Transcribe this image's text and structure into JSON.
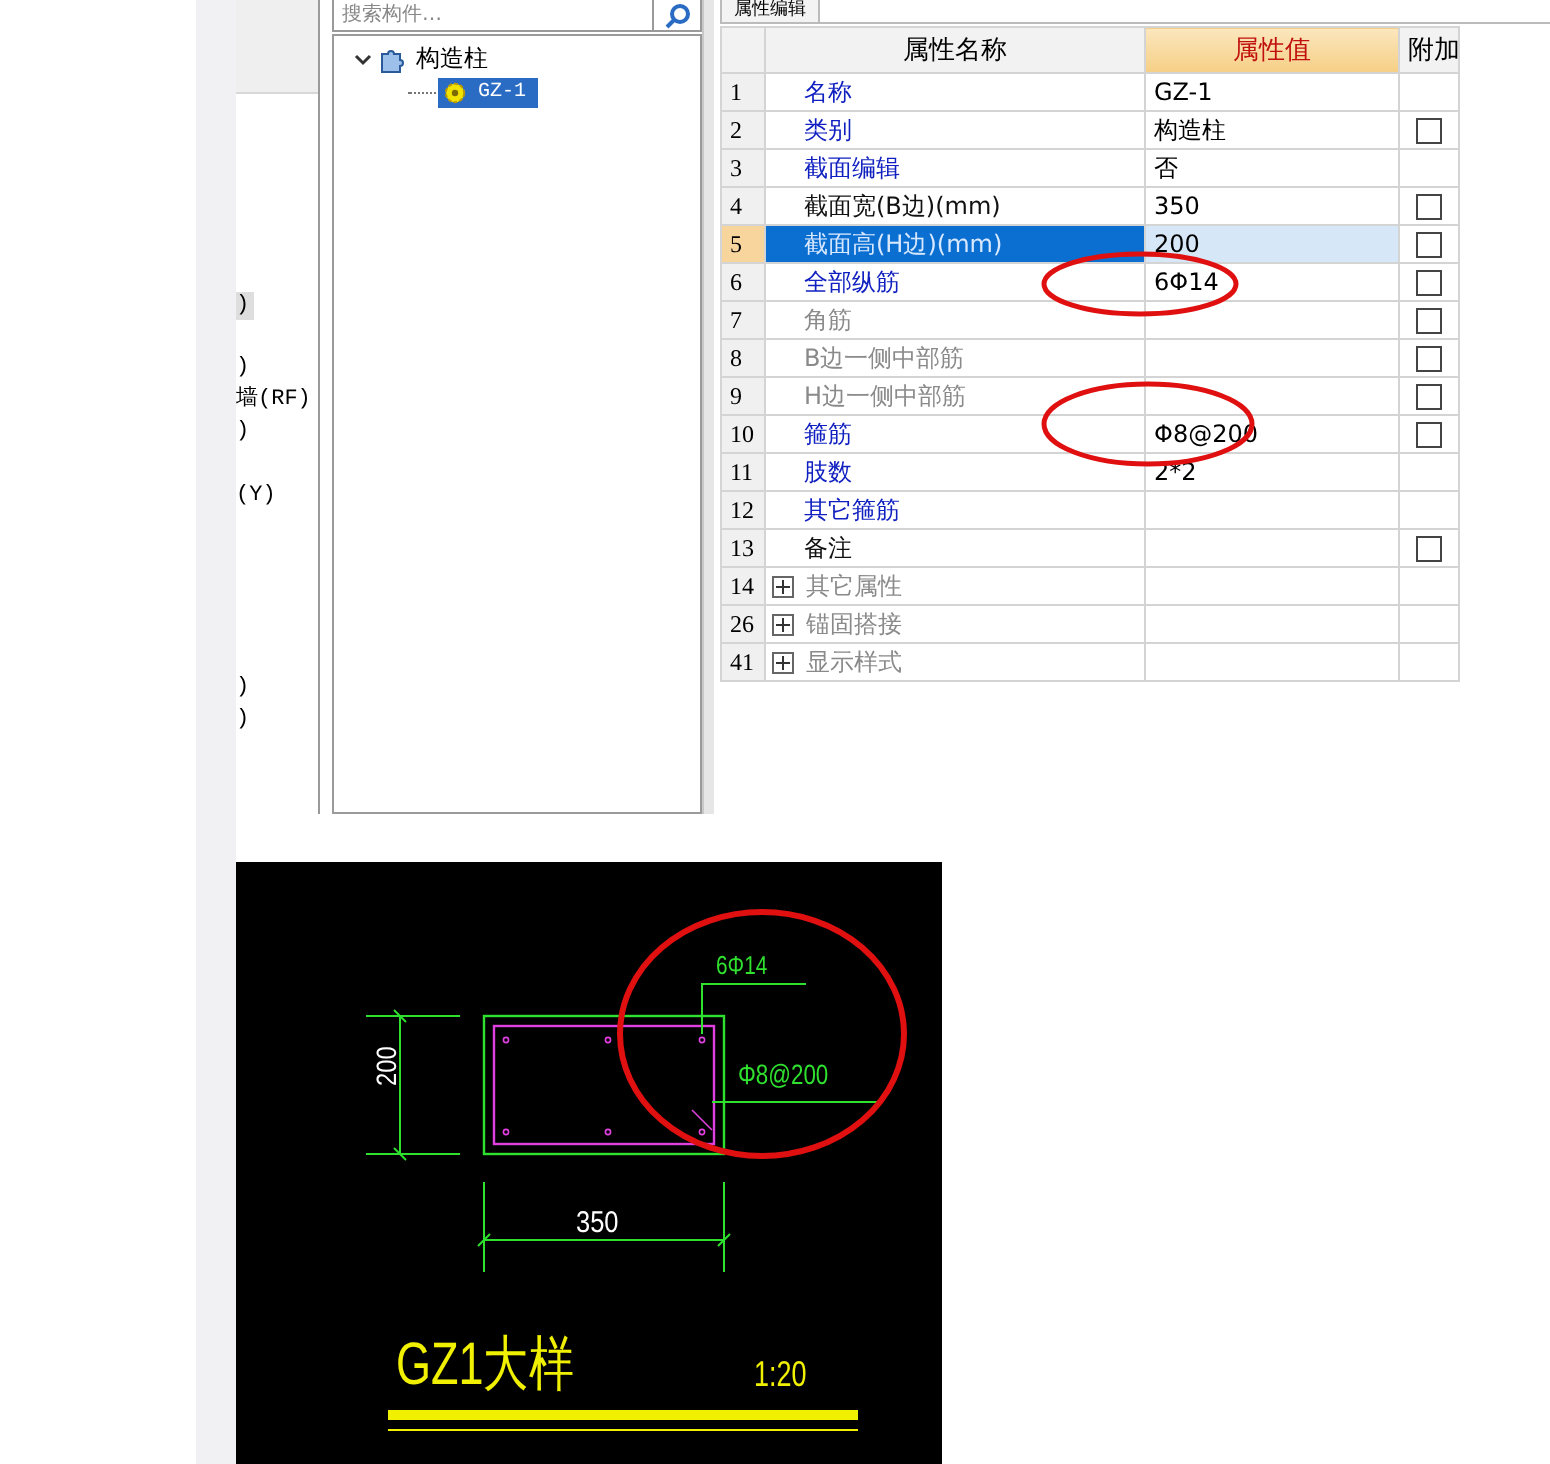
{
  "left_panel": {
    "lines": [
      {
        "text": ")",
        "selected": true
      },
      {
        "text": ")",
        "selected": false
      },
      {
        "text": "墙(RF)",
        "selected": false
      },
      {
        "text": ")",
        "selected": false
      },
      {
        "text": "(Y)",
        "selected": false
      },
      {
        "text": ")",
        "selected": false
      },
      {
        "text": ")",
        "selected": false
      }
    ]
  },
  "component_tree": {
    "search": {
      "placeholder": "搜索构件…"
    },
    "nodes": [
      {
        "label": "构造柱",
        "expanded": true,
        "selected": false,
        "children": [
          {
            "label": "GZ-1",
            "selected": true
          }
        ]
      }
    ]
  },
  "property_editor": {
    "tab": "属性编辑",
    "columns": [
      "属性名称",
      "属性值",
      "附加"
    ],
    "rows": [
      {
        "number": "1",
        "name": "名称",
        "kind": "public",
        "value": "GZ-1",
        "selected": false
      },
      {
        "number": "2",
        "name": "类别",
        "kind": "public",
        "value": "构造柱",
        "selected": false,
        "checked": false
      },
      {
        "number": "3",
        "name": "截面编辑",
        "kind": "public",
        "value": "否",
        "selected": false
      },
      {
        "number": "4",
        "name": "截面宽(B边)(mm)",
        "kind": "private",
        "value": "350",
        "selected": false,
        "checked": false
      },
      {
        "number": "5",
        "name": "截面高(H边)(mm)",
        "kind": "public",
        "value": "200",
        "selected": true,
        "checked": false
      },
      {
        "number": "6",
        "name": "全部纵筋",
        "kind": "public",
        "value": "6Φ14",
        "selected": false,
        "checked": false
      },
      {
        "number": "7",
        "name": "角筋",
        "kind": "inactive",
        "value": "",
        "selected": false,
        "checked": false
      },
      {
        "number": "8",
        "name": "B边一侧中部筋",
        "kind": "inactive",
        "selected": false,
        "checked": false
      },
      {
        "number": "9",
        "name": "H边一侧中部筋",
        "kind": "inactive",
        "selected": false,
        "checked": false
      },
      {
        "number": "10",
        "name": "箍筋",
        "kind": "public",
        "value": "Φ8@200",
        "selected": false,
        "checked": false
      },
      {
        "number": "11",
        "name": "肢数",
        "kind": "public",
        "value": "2*2",
        "selected": false
      },
      {
        "number": "12",
        "name": "其它箍筋",
        "kind": "public",
        "selected": false
      },
      {
        "number": "13",
        "name": "备注",
        "kind": "private",
        "selected": false,
        "checked": false
      },
      {
        "number": "14",
        "name": "其它属性",
        "kind": "group",
        "expanded": false,
        "selected": false
      },
      {
        "number": "26",
        "name": "锚固搭接",
        "kind": "group",
        "expanded": false,
        "selected": false
      },
      {
        "number": "41",
        "name": "显示样式",
        "kind": "group",
        "expanded": false,
        "selected": false
      }
    ]
  },
  "detail_drawing": {
    "height_dimension": "200",
    "width_dimension": "350",
    "longitudinal_rebar": "6Φ14",
    "stirrup": "Φ8@200",
    "title": "GZ1大样",
    "scale": "1:20"
  }
}
